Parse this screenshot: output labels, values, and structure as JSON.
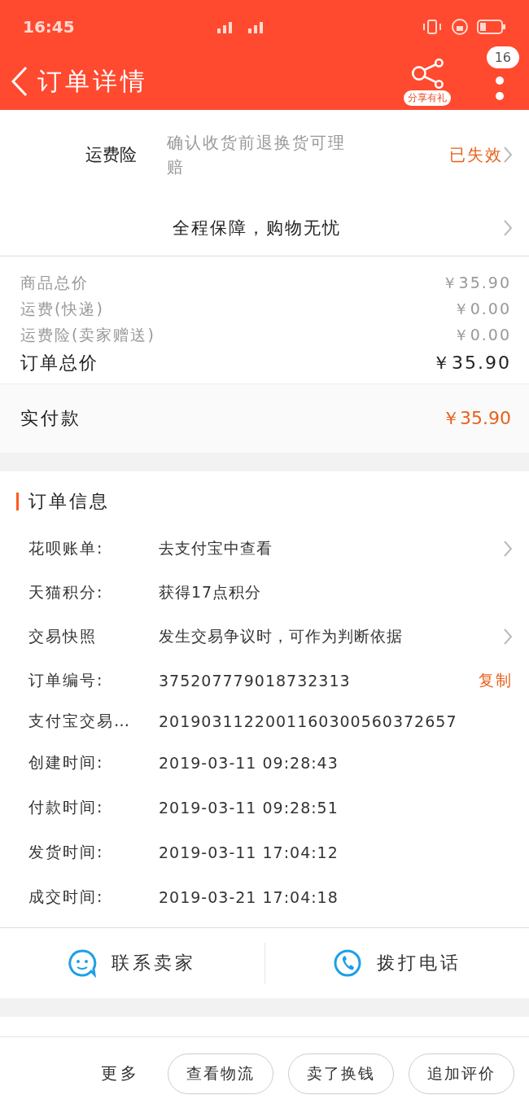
{
  "status_bar": {
    "time": "16:45"
  },
  "header": {
    "title": "订单详情",
    "share_label": "分享有礼",
    "badge": "16"
  },
  "insurance": {
    "label": "运费险",
    "description": "确认收货前退换货可理赔",
    "status": "已失效"
  },
  "guarantee": {
    "text": "全程保障，购物无忧"
  },
  "prices": [
    {
      "label": "商品总价",
      "value": "￥35.90",
      "kind": "minor"
    },
    {
      "label": "运费(快递)",
      "value": "￥0.00",
      "kind": "minor"
    },
    {
      "label": "运费险(卖家赠送)",
      "value": "￥0.00",
      "kind": "minor"
    },
    {
      "label": "订单总价",
      "value": "￥35.90",
      "kind": "total"
    }
  ],
  "paid": {
    "label": "实付款",
    "value": "￥35.90"
  },
  "order_info": {
    "title": "订单信息",
    "rows": [
      {
        "label": "花呗账单:",
        "value": "去支付宝中查看",
        "kind": "chevron"
      },
      {
        "label": "天猫积分:",
        "value": "获得17点积分",
        "kind": "plain"
      },
      {
        "label": "交易快照",
        "value": "发生交易争议时，可作为判断依据",
        "kind": "chevron"
      },
      {
        "label": "订单编号:",
        "value": "375207779018732313",
        "kind": "copy",
        "action": "复制"
      },
      {
        "label": "支付宝交易…",
        "value": "2019031122001160300560372657",
        "kind": "plain"
      },
      {
        "label": "创建时间:",
        "value": "2019-03-11 09:28:43",
        "kind": "plain"
      },
      {
        "label": "付款时间:",
        "value": "2019-03-11 09:28:51",
        "kind": "plain"
      },
      {
        "label": "发货时间:",
        "value": "2019-03-11 17:04:12",
        "kind": "plain"
      },
      {
        "label": "成交时间:",
        "value": "2019-03-21 17:04:18",
        "kind": "plain"
      }
    ]
  },
  "contact": [
    {
      "label": "联系卖家",
      "kind": "chat"
    },
    {
      "label": "拨打电话",
      "kind": "phone"
    }
  ],
  "bottom_bar": {
    "more": "更多",
    "buttons": [
      "查看物流",
      "卖了换钱",
      "追加评价"
    ]
  }
}
